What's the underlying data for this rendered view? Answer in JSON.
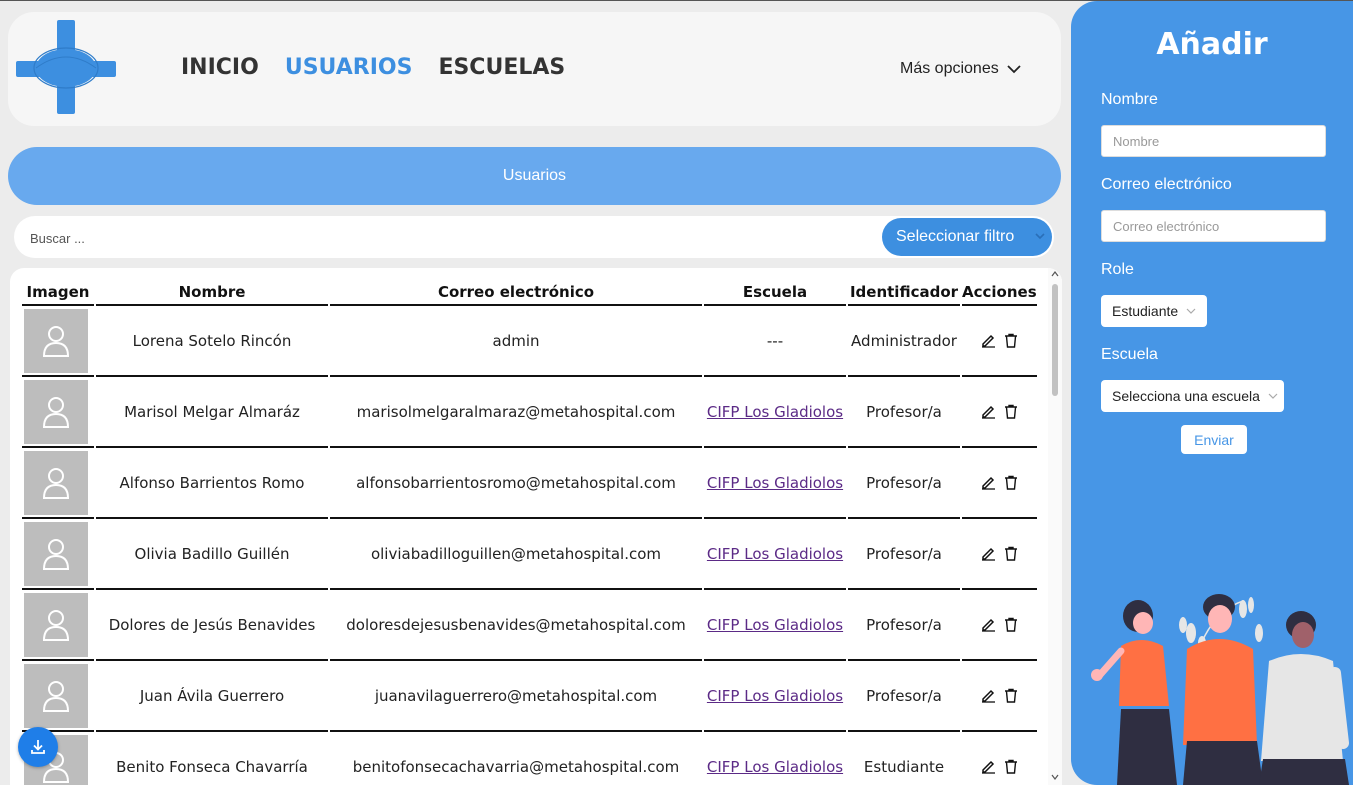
{
  "nav": {
    "items": [
      {
        "label": "INICIO",
        "active": false
      },
      {
        "label": "USUARIOS",
        "active": true
      },
      {
        "label": "ESCUELAS",
        "active": false
      }
    ],
    "more_label": "Más opciones"
  },
  "banner": {
    "title": "Usuarios"
  },
  "search": {
    "placeholder": "Buscar ...",
    "filter_label": "Seleccionar filtro"
  },
  "table": {
    "headers": [
      "Imagen",
      "Nombre",
      "Correo electrónico",
      "Escuela",
      "Identificador",
      "Acciones"
    ],
    "rows": [
      {
        "name": "Lorena Sotelo Rincón",
        "email": "admin",
        "school": "---",
        "school_link": false,
        "role": "Administrador"
      },
      {
        "name": "Marisol Melgar Almaráz",
        "email": "marisolmelgaralmaraz@metahospital.com",
        "school": "CIFP Los Gladiolos",
        "school_link": true,
        "role": "Profesor/a"
      },
      {
        "name": "Alfonso Barrientos Romo",
        "email": "alfonsobarrientosromo@metahospital.com",
        "school": "CIFP Los Gladiolos",
        "school_link": true,
        "role": "Profesor/a"
      },
      {
        "name": "Olivia Badillo Guillén",
        "email": "oliviabadilloguillen@metahospital.com",
        "school": "CIFP Los Gladiolos",
        "school_link": true,
        "role": "Profesor/a"
      },
      {
        "name": "Dolores de Jesús Benavides",
        "email": "doloresdejesusbenavides@metahospital.com",
        "school": "CIFP Los Gladiolos",
        "school_link": true,
        "role": "Profesor/a"
      },
      {
        "name": "Juan Ávila Guerrero",
        "email": "juanavilaguerrero@metahospital.com",
        "school": "CIFP Los Gladiolos",
        "school_link": true,
        "role": "Profesor/a"
      },
      {
        "name": "Benito Fonseca Chavarría",
        "email": "benitofonsecachavarria@metahospital.com",
        "school": "CIFP Los Gladiolos",
        "school_link": true,
        "role": "Estudiante"
      }
    ]
  },
  "form": {
    "title": "Añadir",
    "name_label": "Nombre",
    "name_placeholder": "Nombre",
    "email_label": "Correo electrónico",
    "email_placeholder": "Correo electrónico",
    "role_label": "Role",
    "role_value": "Estudiante",
    "school_label": "Escuela",
    "school_value": "Selecciona una escuela",
    "submit_label": "Enviar"
  },
  "colors": {
    "accent": "#3d8fe0",
    "banner": "#68a9ee",
    "panel": "#4796e6",
    "avatar_bg": "#bdbdbd",
    "link": "#5b2a86",
    "illustration_orange": "#ff7043"
  },
  "icons": [
    "medical-cross-logo",
    "chevron-down-icon",
    "user-icon",
    "edit-icon",
    "trash-icon",
    "download-icon"
  ]
}
